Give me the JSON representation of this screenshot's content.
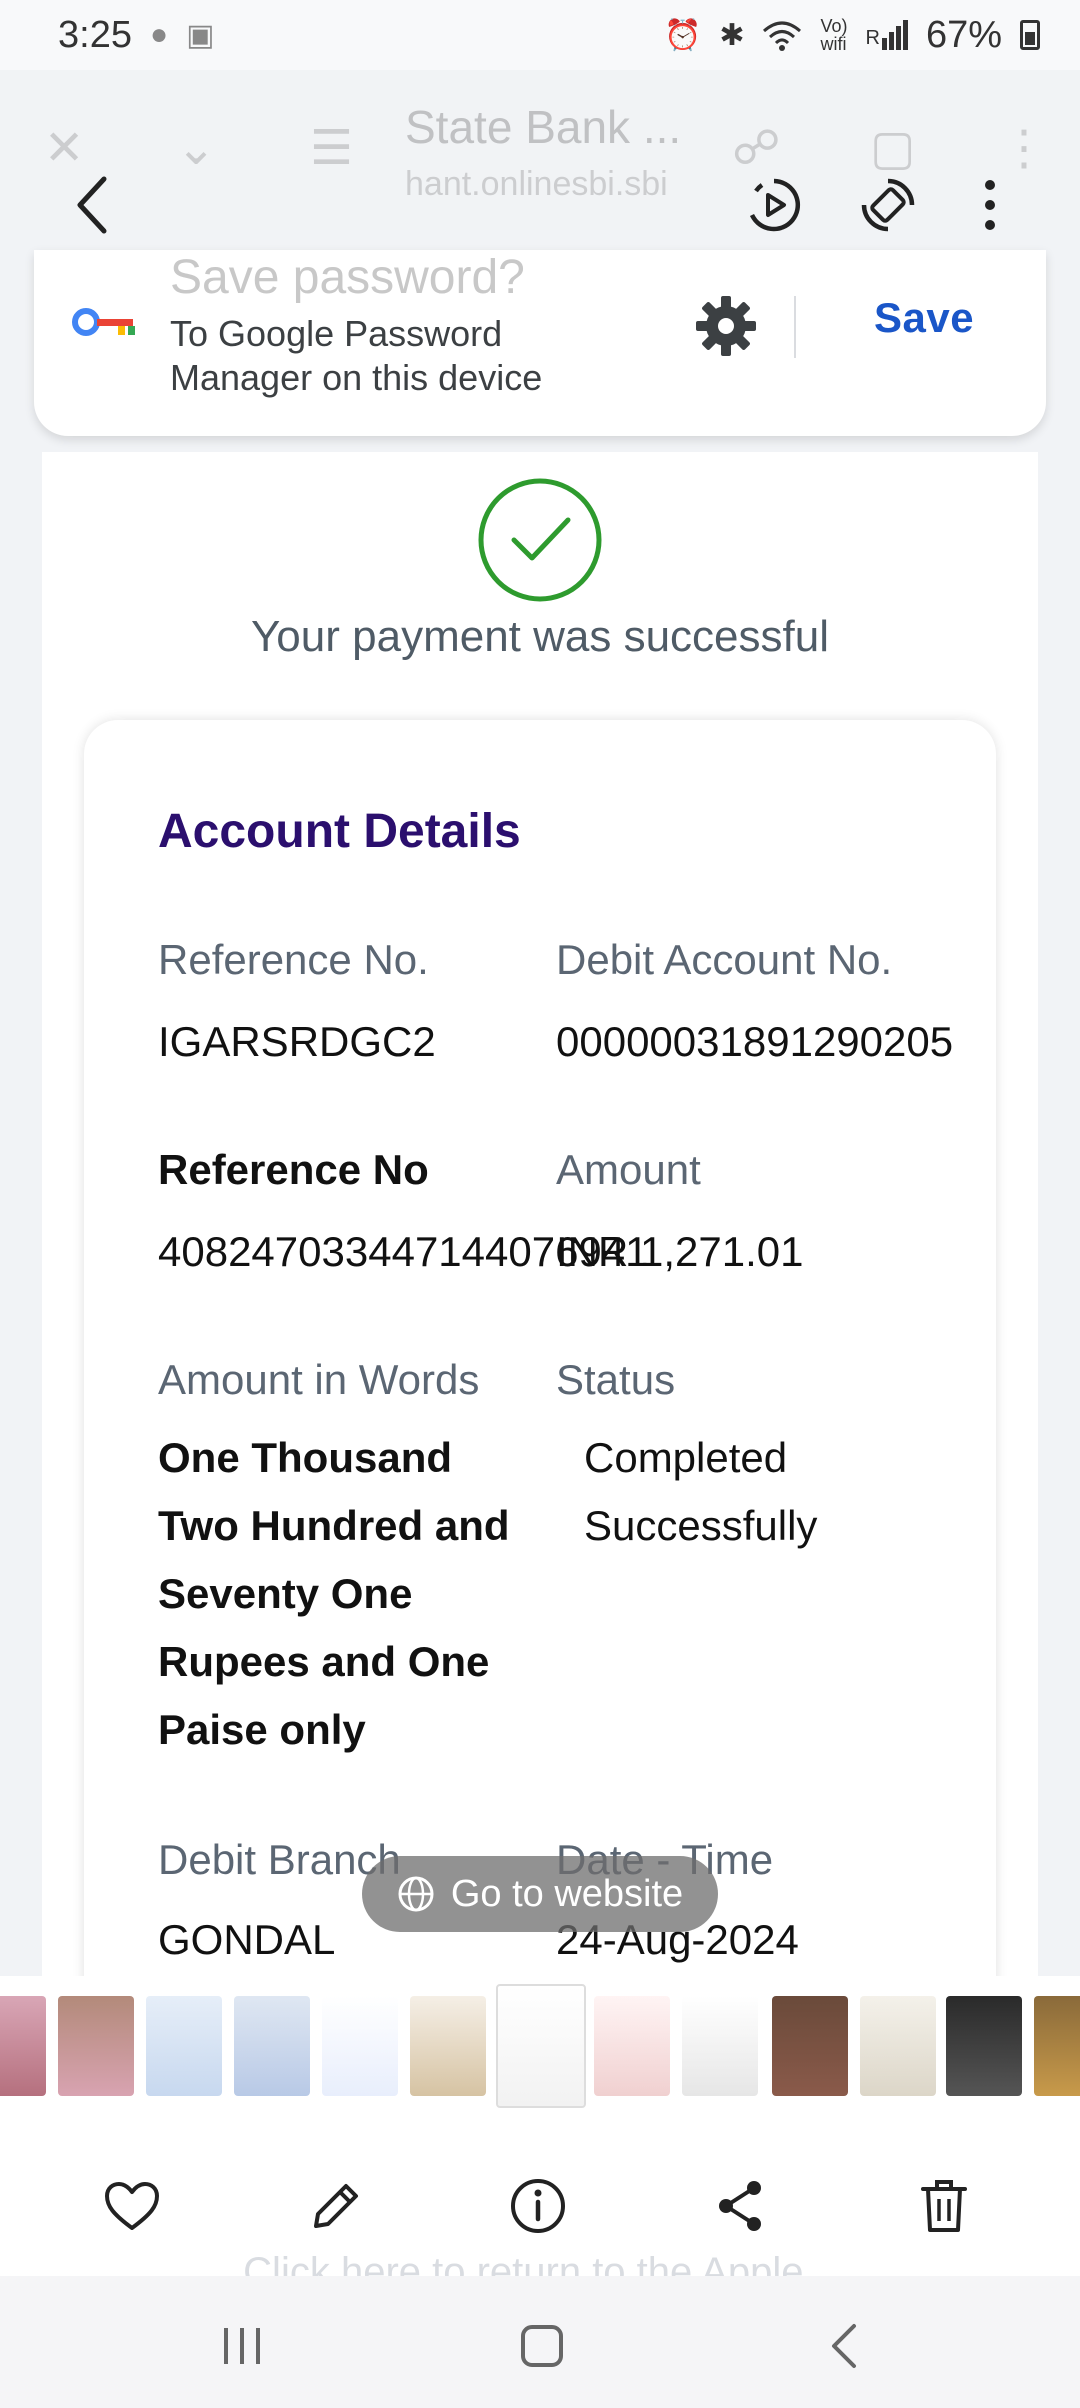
{
  "status_bar": {
    "time": "3:25",
    "battery": "67%",
    "icons": [
      "chat-icon",
      "image-icon",
      "alarm-icon",
      "bluetooth-icon",
      "wifi-icon",
      "volte-icon",
      "signal-icon",
      "battery-icon"
    ],
    "volte_text": "Vo)",
    "wifi_text": "wifi",
    "signal_text": "R"
  },
  "browser_ghost": {
    "title": "State Bank ...",
    "url": "hant.onlinesbi.sbi"
  },
  "viewer_toolbar": {
    "icons": [
      "back-icon",
      "motion-photo-icon",
      "auto-rotate-icon",
      "more-icon"
    ]
  },
  "save_password": {
    "title": "Save password?",
    "description_line1": "To Google Password",
    "description_line2": "Manager on this device",
    "save_label": "Save",
    "accent_color": "#1a56c8"
  },
  "payment": {
    "success_message": "Your payment was successful",
    "success_color": "#2e9b2e"
  },
  "account_details": {
    "title": "Account Details",
    "reference_no_label": "Reference No.",
    "reference_no_value": "IGARSRDGC2",
    "debit_account_label": "Debit Account No.",
    "debit_account_value": "00000031891290205",
    "reference_no2_label": "Reference No",
    "reference_no2_value": "408247033447144076941",
    "amount_label": "Amount",
    "amount_value": "INR 1,271.01",
    "amount_words_label": "Amount in Words",
    "amount_words_lines": [
      "One Thousand",
      "Two Hundred and",
      "Seventy One",
      "Rupees and One",
      "Paise only"
    ],
    "status_label": "Status",
    "status_lines": [
      "Completed",
      "Successfully"
    ],
    "debit_branch_label": "Debit Branch",
    "debit_branch_value": "GONDAL",
    "date_time_label": "Date - Time",
    "date_time_value": "24-Aug-2024"
  },
  "go_to_website": {
    "label": "Go to website"
  },
  "actions": {
    "icons": [
      "heart-icon",
      "edit-icon",
      "info-icon",
      "share-icon",
      "delete-icon"
    ]
  },
  "ghost_bottom_text": "Click here to return to the Apple..."
}
